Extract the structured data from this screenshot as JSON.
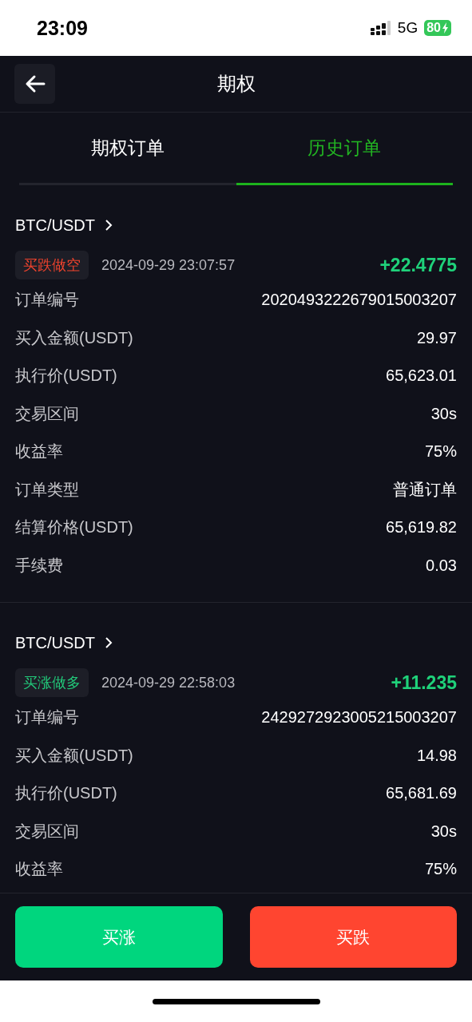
{
  "status_bar": {
    "time": "23:09",
    "network": "5G",
    "battery": "80"
  },
  "header": {
    "title": "期权"
  },
  "tabs": [
    {
      "label": "期权订单",
      "selected": false
    },
    {
      "label": "历史订单",
      "selected": true
    }
  ],
  "orders": [
    {
      "pair": "BTC/USDT",
      "direction": {
        "label": "买跌做空",
        "kind": "short"
      },
      "time": "2024-09-29 23:07:57",
      "profit": "+22.4775",
      "fields": [
        {
          "label": "订单编号",
          "value": "2020493222679015003207"
        },
        {
          "label": "买入金额(USDT)",
          "value": "29.97"
        },
        {
          "label": "执行价(USDT)",
          "value": "65,623.01"
        },
        {
          "label": "交易区间",
          "value": "30s"
        },
        {
          "label": "收益率",
          "value": "75%"
        },
        {
          "label": "订单类型",
          "value": "普通订单"
        },
        {
          "label": "结算价格(USDT)",
          "value": "65,619.82"
        },
        {
          "label": "手续费",
          "value": "0.03"
        }
      ]
    },
    {
      "pair": "BTC/USDT",
      "direction": {
        "label": "买涨做多",
        "kind": "long"
      },
      "time": "2024-09-29 22:58:03",
      "profit": "+11.235",
      "fields": [
        {
          "label": "订单编号",
          "value": "2429272923005215003207"
        },
        {
          "label": "买入金额(USDT)",
          "value": "14.98"
        },
        {
          "label": "执行价(USDT)",
          "value": "65,681.69"
        },
        {
          "label": "交易区间",
          "value": "30s"
        },
        {
          "label": "收益率",
          "value": "75%"
        }
      ]
    }
  ],
  "actions": [
    {
      "label": "买涨",
      "kind": "long"
    },
    {
      "label": "买跌",
      "kind": "short"
    }
  ]
}
